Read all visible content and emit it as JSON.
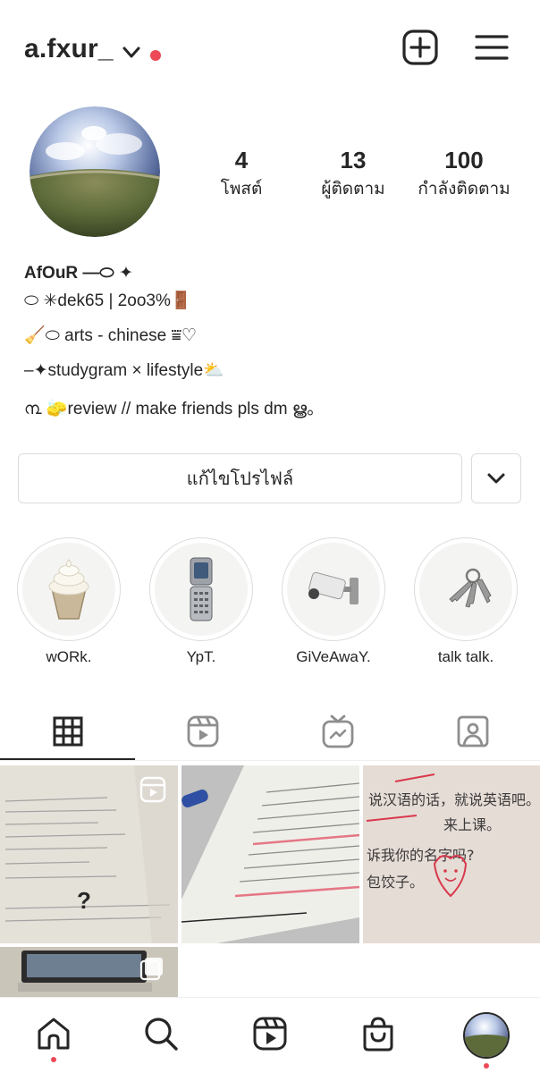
{
  "colors": {
    "accent_red": "#ed4956",
    "text": "#262626",
    "border": "#dbdbdb"
  },
  "header": {
    "username": "a.fxur_",
    "icons": [
      "chevron-down-icon",
      "live-dot",
      "create-post-icon",
      "hamburger-menu-icon"
    ]
  },
  "stats": [
    {
      "value": "4",
      "label": "โพสต์"
    },
    {
      "value": "13",
      "label": "ผู้ติดตาม"
    },
    {
      "value": "100",
      "label": "กำลังติดตาม"
    }
  ],
  "bio": {
    "name": "AfOuR ―⬭ ✦",
    "lines": [
      "⬭ ✳dek65 | 2oo3%🚪",
      "🧹⬭ arts - chinese ⩸♡",
      "‒✦studygram × lifestyle⛅",
      "൩ 🧽review // make friends pls dm ൠ。"
    ]
  },
  "buttons": {
    "edit_profile": "แก้ไขโปรไฟล์"
  },
  "highlights": [
    {
      "label": "wORk.",
      "icon": "soft-serve-icon"
    },
    {
      "label": "YpT.",
      "icon": "flip-phone-icon"
    },
    {
      "label": "GiVeAwaY.",
      "icon": "cctv-camera-icon"
    },
    {
      "label": "talk talk.",
      "icon": "keys-icon"
    }
  ],
  "tabs": [
    {
      "name": "grid",
      "icon": "grid-icon"
    },
    {
      "name": "reels",
      "icon": "reels-icon"
    },
    {
      "name": "igtv",
      "icon": "igtv-icon"
    },
    {
      "name": "tagged",
      "icon": "tagged-icon"
    }
  ],
  "posts": {
    "tile1_question_mark": "?",
    "tile3_lines": [
      "说汉语的话，就说英语吧。",
      "来上课。",
      "诉我你的名字吗?",
      "包饺子。"
    ]
  },
  "bottom_nav": [
    "home-icon",
    "search-icon",
    "reels-icon",
    "shop-icon",
    "profile-avatar"
  ]
}
